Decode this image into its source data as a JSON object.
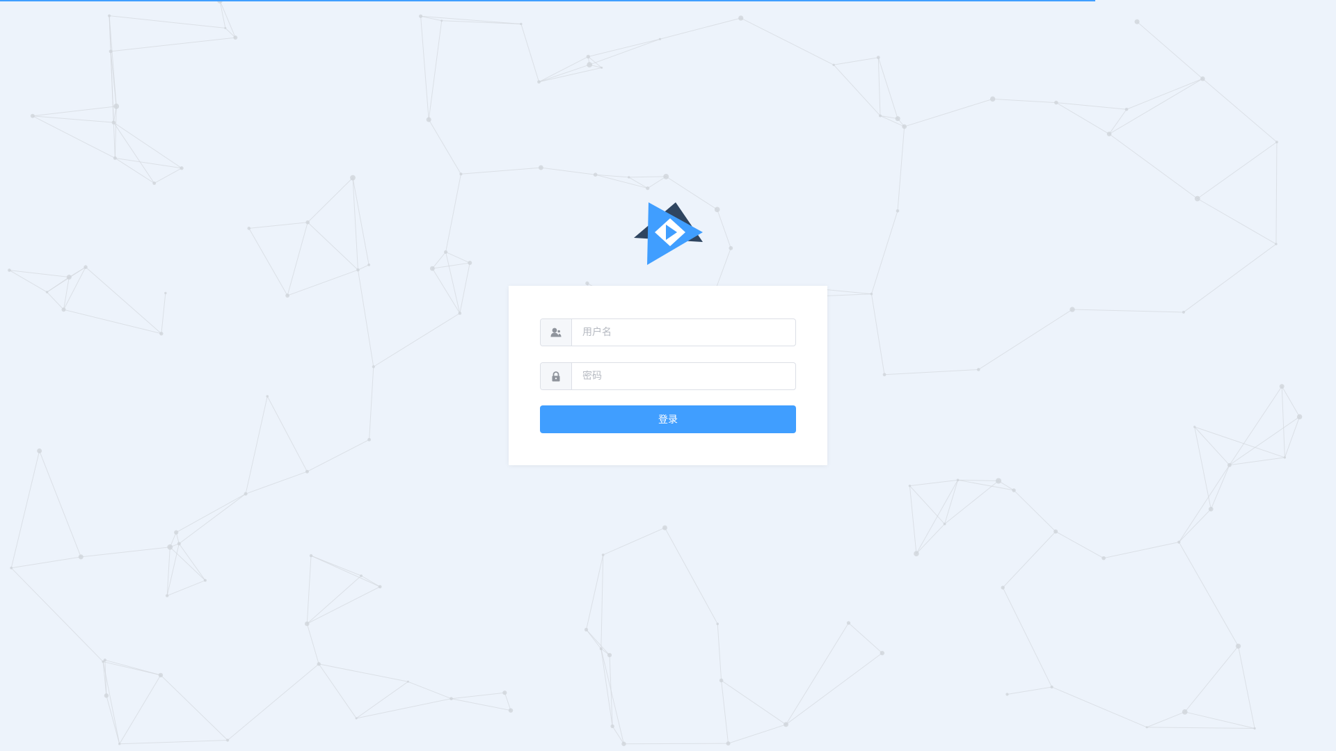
{
  "login_form": {
    "username_placeholder": "用户名",
    "password_placeholder": "密码",
    "submit_label": "登录"
  },
  "icons": {
    "logo": "play-triangle-logo-icon",
    "username": "user-icon",
    "password": "lock-icon"
  },
  "colors": {
    "background": "#edf3fb",
    "accent": "#409eff",
    "logo_dark": "#2f4560",
    "logo_light": "#409eff",
    "network_lines": "#d4d8de"
  },
  "page_load_progress": 0.82
}
